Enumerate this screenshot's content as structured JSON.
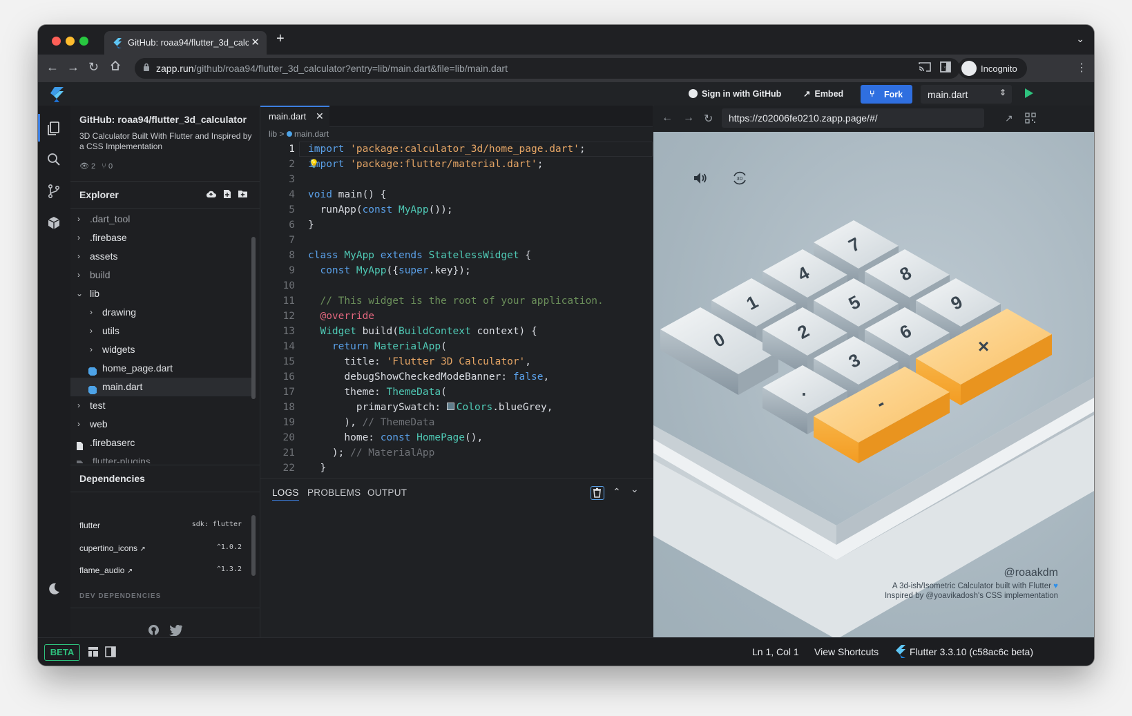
{
  "browser": {
    "tab_title": "GitHub: roaa94/flutter_3d_calc",
    "url_host": "zapp.run",
    "url_path": "/github/roaa94/flutter_3d_calculator?entry=lib/main.dart&file=lib/main.dart",
    "incognito_label": "Incognito"
  },
  "header": {
    "sign_in": "Sign in with GitHub",
    "embed": "Embed",
    "fork": "Fork",
    "file_select": "main.dart"
  },
  "project": {
    "title": "GitHub: roaa94/flutter_3d_calculator",
    "description": "3D Calculator Built With Flutter and Inspired by a CSS Implementation",
    "watchers": "2",
    "forks": "0"
  },
  "explorer": {
    "title": "Explorer",
    "items": [
      {
        "label": ".dart_tool",
        "type": "folder",
        "dim": true
      },
      {
        "label": ".firebase",
        "type": "folder",
        "dim": false
      },
      {
        "label": "assets",
        "type": "folder",
        "dim": false
      },
      {
        "label": "build",
        "type": "folder",
        "dim": true
      },
      {
        "label": "lib",
        "type": "folder-open",
        "dim": false
      },
      {
        "label": "drawing",
        "type": "folder",
        "dim": false
      },
      {
        "label": "utils",
        "type": "folder",
        "dim": false
      },
      {
        "label": "widgets",
        "type": "folder",
        "dim": false
      },
      {
        "label": "home_page.dart",
        "type": "dart",
        "dim": false
      },
      {
        "label": "main.dart",
        "type": "dart",
        "dim": false
      },
      {
        "label": "test",
        "type": "folder",
        "dim": false
      },
      {
        "label": "web",
        "type": "folder",
        "dim": false
      },
      {
        "label": ".firebaserc",
        "type": "file",
        "dim": false
      },
      {
        "label": ".flutter-plugins",
        "type": "file",
        "dim": true
      }
    ]
  },
  "dependencies": {
    "title": "Dependencies",
    "items": [
      {
        "name": "flutter",
        "version": "sdk: flutter"
      },
      {
        "name": "cupertino_icons",
        "version": "^1.0.2"
      },
      {
        "name": "flame_audio",
        "version": "^1.3.2"
      }
    ],
    "dev_title": "DEV DEPENDENCIES"
  },
  "editor": {
    "tab": "main.dart",
    "breadcrumb_dir": "lib",
    "breadcrumb_file": "main.dart",
    "line_numbers": [
      "1",
      "2",
      "3",
      "4",
      "5",
      "6",
      "7",
      "8",
      "9",
      "10",
      "11",
      "12",
      "13",
      "14",
      "15",
      "16",
      "17",
      "18",
      "19",
      "20",
      "21",
      "22"
    ],
    "code": {
      "l1_kw": "import",
      "l1_str": "'package:calculator_3d/home_page.dart'",
      "l1_end": ";",
      "l2_kw": "import",
      "l2_str": "'package:flutter/material.dart'",
      "l2_end": ";",
      "l4_kw": "void",
      "l4_rest": " main() {",
      "l5_a": "  runApp(",
      "l5_kw": "const",
      "l5_sp": " ",
      "l5_ty": "MyApp",
      "l5_end": "());",
      "l6": "}",
      "l8_kw": "class",
      "l8_ty": " MyApp",
      "l8_kw2": " extends",
      "l8_ty2": " StatelessWidget",
      "l8_end": " {",
      "l9_kw": "  const",
      "l9_ty": " MyApp",
      "l9_a": "({",
      "l9_kw2": "super",
      "l9_end": ".key});",
      "l11": "  // This widget is the root of your application.",
      "l12": "  @override",
      "l13_ty": "  Widget",
      "l13_a": " build(",
      "l13_ty2": "BuildContext",
      "l13_end": " context) {",
      "l14_kw": "    return",
      "l14_ty": " MaterialApp",
      "l14_end": "(",
      "l15_a": "      title: ",
      "l15_str": "'Flutter 3D Calculator'",
      "l15_end": ",",
      "l16_a": "      debugShowCheckedModeBanner: ",
      "l16_kw": "false",
      "l16_end": ",",
      "l17_a": "      theme: ",
      "l17_ty": "ThemeData",
      "l17_end": "(",
      "l18_a": "        primarySwatch: ",
      "l18_ty": "Colors",
      "l18_end": ".blueGrey,",
      "l19_a": "      ), ",
      "l19_cm": "// ThemeData",
      "l20_a": "      home: ",
      "l20_kw": "const",
      "l20_ty": " HomePage",
      "l20_end": "(),",
      "l21_a": "    ); ",
      "l21_cm": "// MaterialApp",
      "l22": "  }"
    }
  },
  "panel": {
    "tabs": [
      "LOGS",
      "PROBLEMS",
      "OUTPUT"
    ]
  },
  "preview": {
    "url": "https://z02006fe0210.zapp.page/#/",
    "author": "@roaakdm",
    "line1": "A 3d-ish/Isometric Calculator built with Flutter",
    "line2": "Inspired by @yoavikadosh's CSS implementation",
    "keys": [
      "7",
      "4",
      "8",
      "1",
      "5",
      "9",
      "0",
      "2",
      "6",
      "×",
      "3",
      ".",
      "-"
    ]
  },
  "status": {
    "beta": "BETA",
    "position": "Ln 1, Col 1",
    "shortcuts": "View Shortcuts",
    "flutter": "Flutter 3.3.10  (c58ac6c beta)"
  },
  "colors": {
    "accent": "#2f6fe0",
    "beta_green": "#2ec27e",
    "orange_key": "#f6b54a"
  }
}
